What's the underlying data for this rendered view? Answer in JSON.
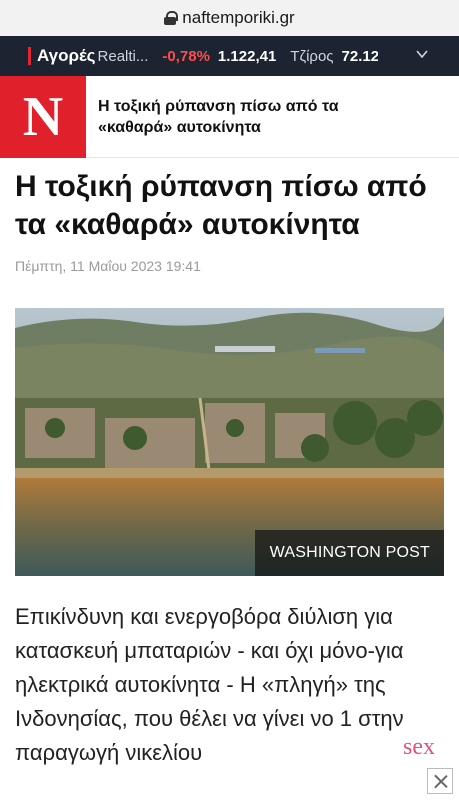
{
  "browser": {
    "url": "naftemporiki.gr"
  },
  "ticker": {
    "markets_label": "Αγορές",
    "stock_name": "Realti...",
    "change": "-0,78%",
    "index_value": "1.122,41",
    "turnover_label": "Τζίρος",
    "turnover_value": "72.12",
    "icons": {
      "expand": "chevron-down-icon"
    }
  },
  "header": {
    "logo_letter": "N",
    "title": "Η τοξική ρύπανση πίσω από τα «καθαρά» αυτοκίνητα",
    "brand_color": "#e0202b"
  },
  "article": {
    "title": "Η τοξική ρύπανση πίσω από τα «καθαρά» αυτοκίνητα",
    "date": "Πέμπτη, 11 Μαΐου 2023 19:41",
    "image_credit": "WASHINGTON POST",
    "lead": "Επικίνδυνη και ενεργοβόρα διύλιση για κατασκευή μπαταριών - και όχι μόνο-για ηλεκτρικά αυτοκίνητα - Η «πληγή» της Ινδονησίας, που θέλει να γίνει νο 1 στην παραγωγή νικελίου"
  },
  "ad_watermark": {
    "text": "sex",
    "icon": "close-icon"
  }
}
